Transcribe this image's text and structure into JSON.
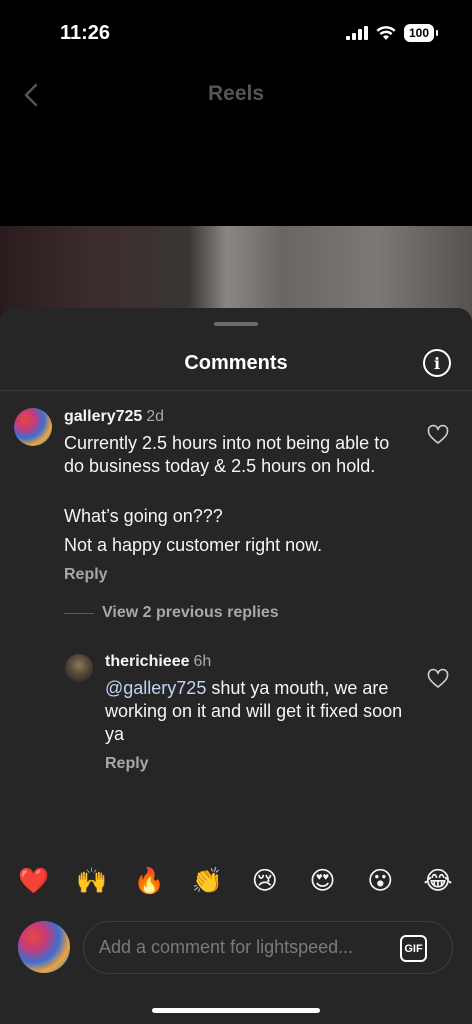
{
  "status_bar": {
    "time": "11:26",
    "battery": "100"
  },
  "nav": {
    "title": "Reels"
  },
  "sheet": {
    "title": "Comments",
    "info_icon": "info-icon"
  },
  "comments": [
    {
      "user": "gallery725",
      "time": "2d",
      "lines": [
        "Currently 2.5 hours into not being able to do business today & 2.5 hours on hold.",
        "What’s going on???",
        "Not a happy customer right now."
      ],
      "reply_label": "Reply"
    }
  ],
  "view_replies_label": "View 2 previous replies",
  "replies": [
    {
      "user": "therichieee",
      "time": "6h",
      "mention": "@gallery725",
      "text": " shut ya mouth, we are working on it and will get it fixed soon ya",
      "reply_label": "Reply"
    }
  ],
  "emoji_reactions": [
    "❤️",
    "🙌",
    "🔥",
    "👏",
    "😢",
    "😍",
    "😮",
    "😂"
  ],
  "composer": {
    "placeholder": "Add a comment for lightspeed...",
    "gif_label": "GIF"
  },
  "colors": {
    "sheet_bg": "#262626",
    "text": "#f5f5f5",
    "secondary_text": "#a8a8a8",
    "mention": "#c4d4f5"
  }
}
